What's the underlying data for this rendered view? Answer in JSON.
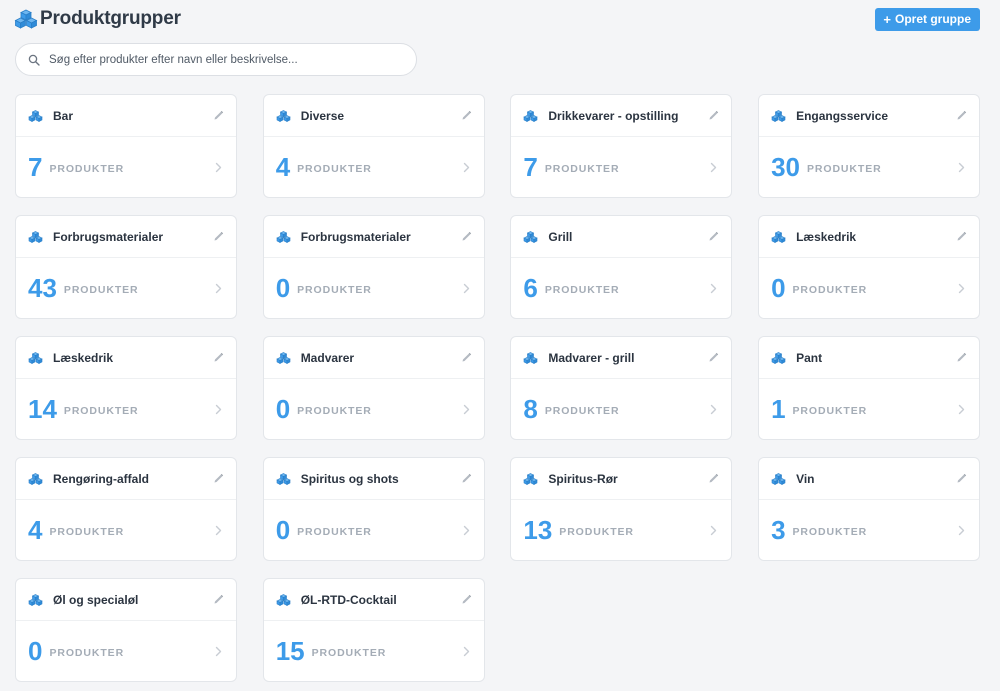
{
  "header": {
    "title": "Produktgrupper",
    "create_button": "Opret gruppe",
    "create_icon": "+"
  },
  "search": {
    "placeholder": "Søg efter produkter efter navn eller beskrivelse..."
  },
  "colors": {
    "accent": "#3d9be9",
    "label_gray": "#a4acb6",
    "background": "#f4f5f7"
  },
  "icons": {
    "logo": "cubes-icon",
    "group": "cubes-icon",
    "edit": "pencil-icon",
    "open": "chevron-right-icon",
    "search": "search-icon"
  },
  "groups": [
    {
      "name": "Bar",
      "count": "7",
      "unit": "PRODUKTER"
    },
    {
      "name": "Diverse",
      "count": "4",
      "unit": "PRODUKTER"
    },
    {
      "name": "Drikkevarer - opstilling",
      "count": "7",
      "unit": "PRODUKTER"
    },
    {
      "name": "Engangsservice",
      "count": "30",
      "unit": "PRODUKTER"
    },
    {
      "name": "Forbrugsmaterialer",
      "count": "43",
      "unit": "PRODUKTER"
    },
    {
      "name": "Forbrugsmaterialer",
      "count": "0",
      "unit": "PRODUKTER"
    },
    {
      "name": "Grill",
      "count": "6",
      "unit": "PRODUKTER"
    },
    {
      "name": "Læskedrik",
      "count": "0",
      "unit": "PRODUKTER"
    },
    {
      "name": "Læskedrik",
      "count": "14",
      "unit": "PRODUKTER"
    },
    {
      "name": "Madvarer",
      "count": "0",
      "unit": "PRODUKTER"
    },
    {
      "name": "Madvarer - grill",
      "count": "8",
      "unit": "PRODUKTER"
    },
    {
      "name": "Pant",
      "count": "1",
      "unit": "PRODUKTER"
    },
    {
      "name": "Rengøring-affald",
      "count": "4",
      "unit": "PRODUKTER"
    },
    {
      "name": "Spiritus og shots",
      "count": "0",
      "unit": "PRODUKTER"
    },
    {
      "name": "Spiritus-Rør",
      "count": "13",
      "unit": "PRODUKTER"
    },
    {
      "name": "Vin",
      "count": "3",
      "unit": "PRODUKTER"
    },
    {
      "name": "Øl og specialøl",
      "count": "0",
      "unit": "PRODUKTER"
    },
    {
      "name": "ØL-RTD-Cocktail",
      "count": "15",
      "unit": "PRODUKTER"
    }
  ]
}
